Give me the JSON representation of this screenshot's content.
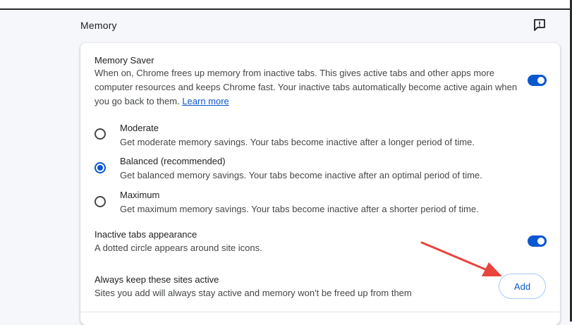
{
  "section": {
    "title": "Memory"
  },
  "memory_saver": {
    "label": "Memory Saver",
    "desc_line1": "When on, Chrome frees up memory from inactive tabs. This gives active tabs and other apps more",
    "desc_line2": "computer resources and keeps Chrome fast. Your inactive tabs automatically become active again when",
    "desc_line3_prefix": "you go back to them.",
    "learn_more": "Learn more",
    "enabled": true
  },
  "options": [
    {
      "title": "Moderate",
      "desc": "Get moderate memory savings. Your tabs become inactive after a longer period of time.",
      "checked": false
    },
    {
      "title": "Balanced (recommended)",
      "desc": "Get balanced memory savings. Your tabs become inactive after an optimal period of time.",
      "checked": true
    },
    {
      "title": "Maximum",
      "desc": "Get maximum memory savings. Your tabs become inactive after a shorter period of time.",
      "checked": false
    }
  ],
  "inactive_tabs": {
    "label": "Inactive tabs appearance",
    "desc": "A dotted circle appears around site icons.",
    "enabled": true
  },
  "keep_active": {
    "label": "Always keep these sites active",
    "desc": "Sites you add will always stay active and memory won't be freed up from them",
    "add_label": "Add"
  },
  "colors": {
    "accent": "#0b57d0",
    "annotation_arrow": "#e8453c"
  },
  "icons": {
    "feedback": "feedback-icon",
    "arrow": "annotation-arrow-icon"
  }
}
